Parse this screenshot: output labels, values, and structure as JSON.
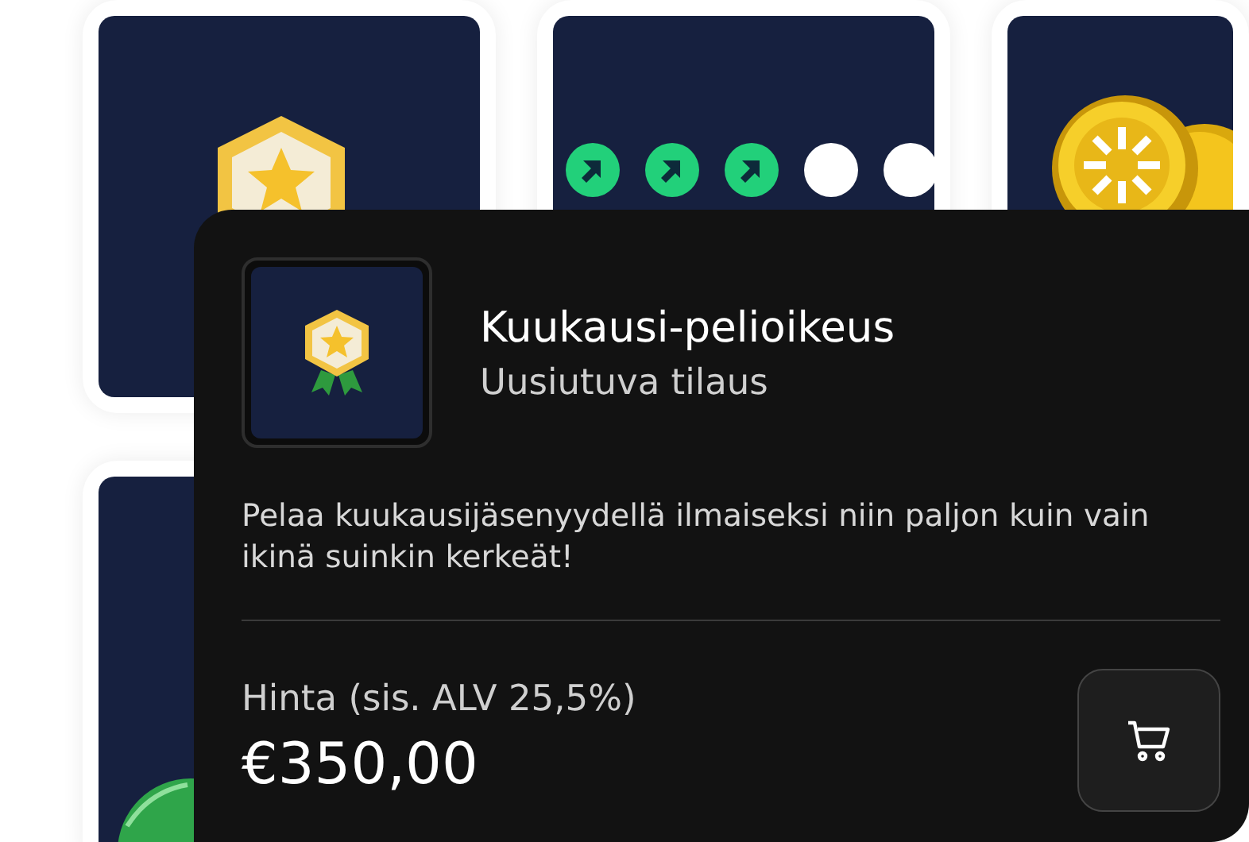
{
  "cards": [
    {
      "kind": "badge"
    },
    {
      "kind": "dots",
      "dots": [
        {
          "on": true
        },
        {
          "on": true
        },
        {
          "on": true
        },
        {
          "on": false
        },
        {
          "on": false
        }
      ]
    },
    {
      "kind": "coins"
    },
    {
      "kind": "ball"
    }
  ],
  "detail": {
    "title": "Kuukausi-pelioikeus",
    "subtitle": "Uusiutuva tilaus",
    "description": "Pelaa kuukausijäsenyydellä ilmaiseksi niin paljon kuin vain ikinä suinkin kerkeät!",
    "price_label": "Hinta (sis. ALV 25,5%)",
    "price": "€350,00"
  }
}
